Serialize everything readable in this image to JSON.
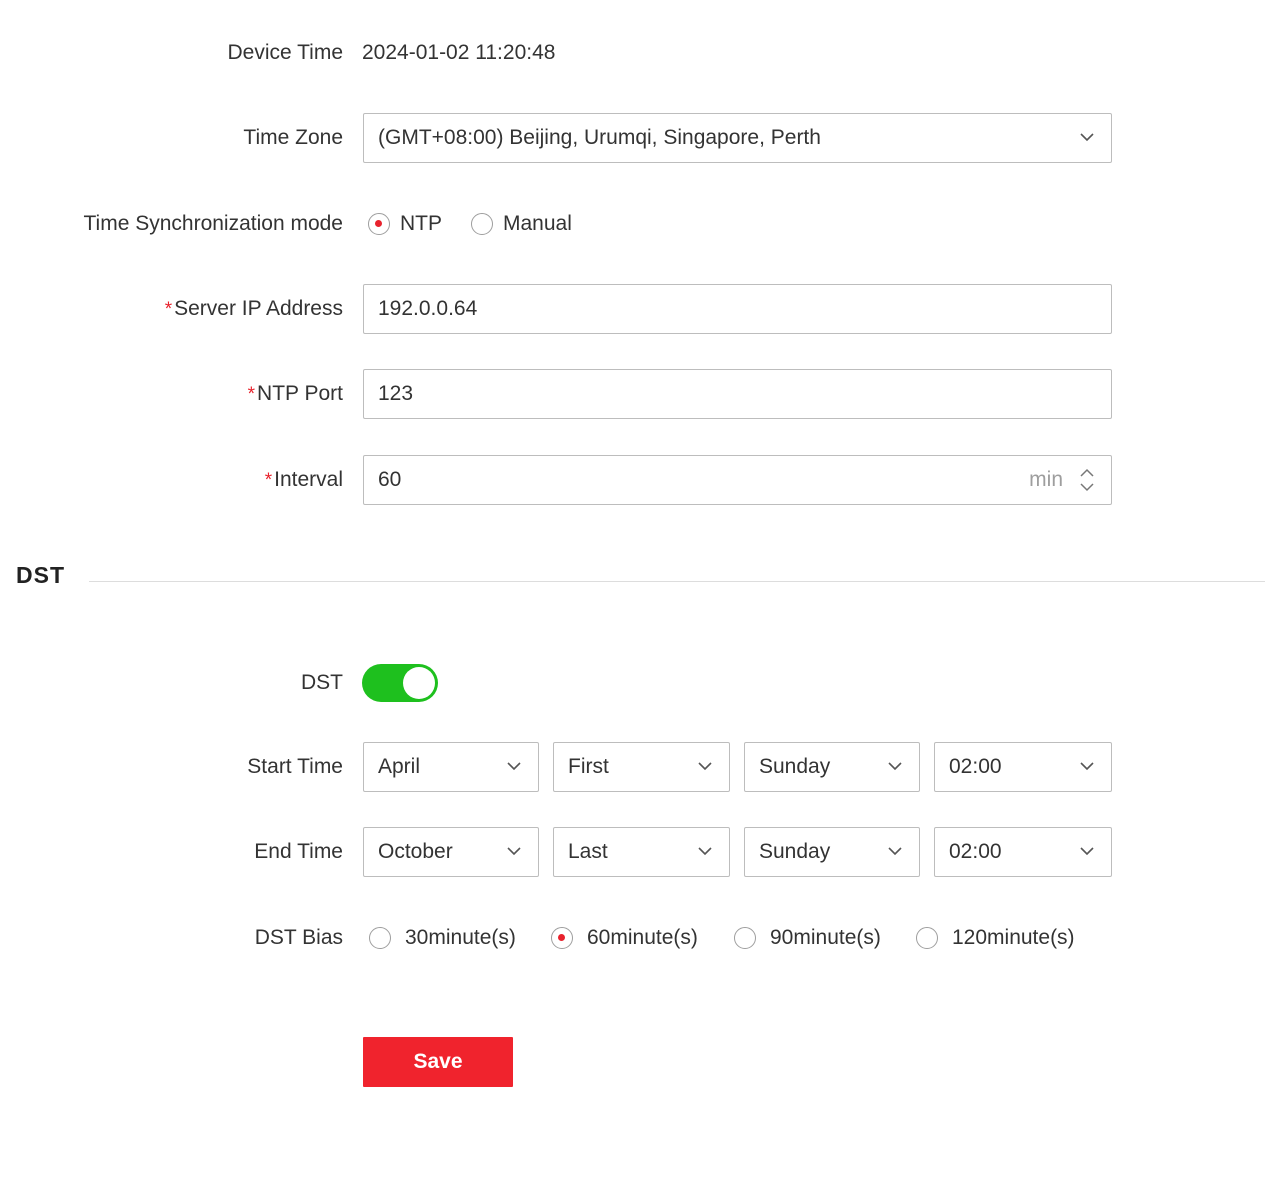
{
  "device_time": {
    "label": "Device Time",
    "value": "2024-01-02 11:20:48"
  },
  "time_zone": {
    "label": "Time Zone",
    "selected": "(GMT+08:00) Beijing, Urumqi, Singapore, Perth"
  },
  "sync_mode": {
    "label": "Time Synchronization mode",
    "options": [
      {
        "label": "NTP",
        "checked": true
      },
      {
        "label": "Manual",
        "checked": false
      }
    ]
  },
  "server_ip": {
    "required_mark": "*",
    "label": "Server IP Address",
    "value": "192.0.0.64"
  },
  "ntp_port": {
    "required_mark": "*",
    "label": "NTP Port",
    "value": "123"
  },
  "interval": {
    "required_mark": "*",
    "label": "Interval",
    "value": "60",
    "unit": "min"
  },
  "dst_section": {
    "title": "DST"
  },
  "dst_toggle": {
    "label": "DST",
    "enabled": true,
    "on_color": "#1ec01e"
  },
  "start_time": {
    "label": "Start Time",
    "month": "April",
    "week": "First",
    "day": "Sunday",
    "time": "02:00"
  },
  "end_time": {
    "label": "End Time",
    "month": "October",
    "week": "Last",
    "day": "Sunday",
    "time": "02:00"
  },
  "dst_bias": {
    "label": "DST Bias",
    "options": [
      {
        "label": "30minute(s)",
        "checked": false
      },
      {
        "label": "60minute(s)",
        "checked": true
      },
      {
        "label": "90minute(s)",
        "checked": false
      },
      {
        "label": "120minute(s)",
        "checked": false
      }
    ]
  },
  "save_button": {
    "label": "Save",
    "color": "#f0232d"
  },
  "icons": {
    "dropdown": "chevron-down-icon",
    "spinner": "spinner-arrows-icon"
  }
}
